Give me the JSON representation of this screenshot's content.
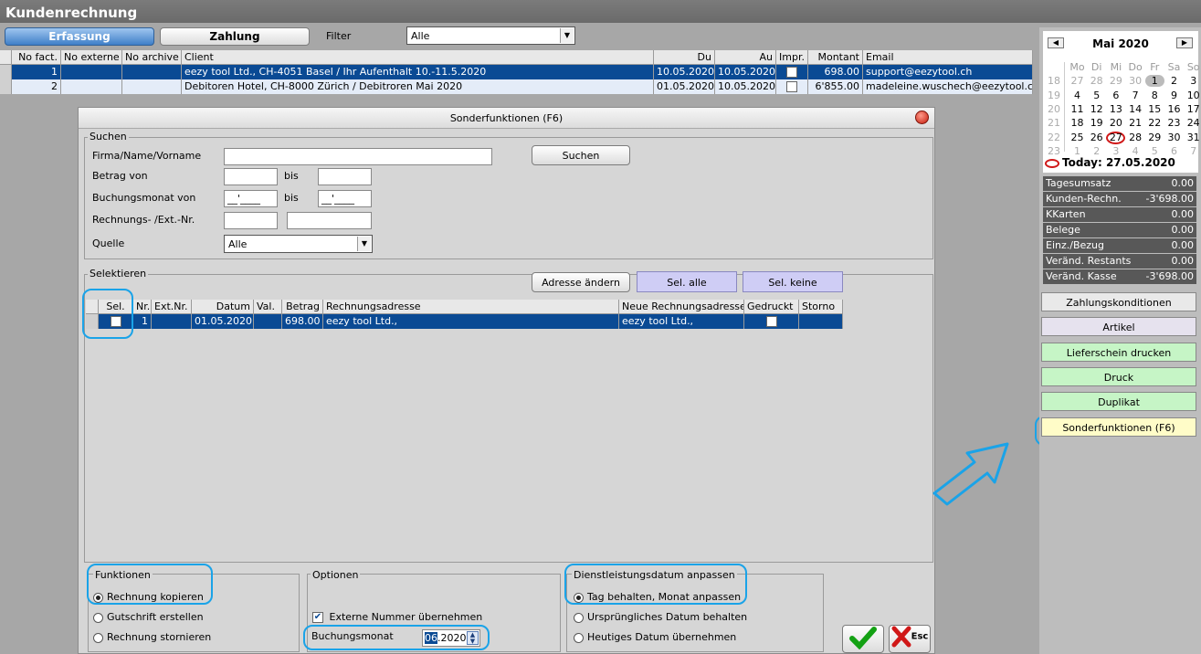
{
  "window": {
    "title": "Kundenrechnung"
  },
  "toolbar": {
    "tab_erfassung": "Erfassung",
    "tab_zahlung": "Zahlung",
    "filter_label": "Filter",
    "filter_value": "Alle"
  },
  "main_table": {
    "headers": [
      "No fact.",
      "No externe",
      "No archive",
      "Client",
      "Du",
      "Au",
      "Impr.",
      "Montant",
      "Email"
    ],
    "rows": [
      {
        "no": "1",
        "ext": "",
        "arch": "",
        "client": "eezy tool Ltd., CH-4051 Basel / Ihr Aufenthalt 10.-11.5.2020",
        "du": "10.05.2020",
        "au": "10.05.2020",
        "montant": "698.00",
        "email": "support@eezytool.ch"
      },
      {
        "no": "2",
        "ext": "",
        "arch": "",
        "client": "Debitoren Hotel, CH-8000 Zürich / Debitroren Mai 2020",
        "du": "01.05.2020",
        "au": "10.05.2020",
        "montant": "6'855.00",
        "email": "madeleine.wuschech@eezytool.ch"
      }
    ]
  },
  "dialog": {
    "title": "Sonderfunktionen (F6)",
    "suchen": {
      "group": "Suchen",
      "firma_label": "Firma/Name/Vorname",
      "betrag_label": "Betrag von",
      "bis1": "bis",
      "buchungsmonat_label": "Buchungsmonat von",
      "buch_from": "__'____",
      "bis2": "bis",
      "buch_to": "__'____",
      "rechnung_label": "Rechnungs- /Ext.-Nr.",
      "quelle_label": "Quelle",
      "quelle_value": "Alle",
      "suchen_button": "Suchen"
    },
    "selektieren": {
      "group": "Selektieren",
      "adresse_button": "Adresse ändern",
      "sel_alle_button": "Sel. alle",
      "sel_keine_button": "Sel. keine",
      "headers": [
        "Sel.",
        "Nr.",
        "Ext.Nr.",
        "Datum",
        "Val.",
        "Betrag",
        "Rechnungsadresse",
        "Neue Rechnungsadresse",
        "Gedruckt",
        "Storno"
      ],
      "rows": [
        {
          "nr": "1",
          "ext": "",
          "datum": "01.05.2020",
          "val": "",
          "betrag": "698.00",
          "adresse": "eezy tool Ltd.,",
          "neue": "eezy tool Ltd.,"
        }
      ]
    },
    "funktionen": {
      "group": "Funktionen",
      "opt1": "Rechnung kopieren",
      "opt2": "Gutschrift erstellen",
      "opt3": "Rechnung stornieren"
    },
    "optionen": {
      "group": "Optionen",
      "externe": "Externe Nummer übernehmen",
      "buchungsmonat_label": "Buchungsmonat",
      "buchungsmonat_value_sel": "06",
      "buchungsmonat_value_rest": ".2020"
    },
    "dienst": {
      "group": "Dienstleistungsdatum anpassen",
      "opt1": "Tag behalten, Monat anpassen",
      "opt2": "Ursprüngliches Datum behalten",
      "opt3": "Heutiges Datum übernehmen"
    },
    "esc_label": "Esc"
  },
  "calendar": {
    "month": "Mai 2020",
    "weekdays": [
      "Mo",
      "Di",
      "Mi",
      "Do",
      "Fr",
      "Sa",
      "So"
    ],
    "weeks": [
      {
        "wk": "18",
        "days": [
          "27",
          "28",
          "29",
          "30",
          "1",
          "2",
          "3"
        ]
      },
      {
        "wk": "19",
        "days": [
          "4",
          "5",
          "6",
          "7",
          "8",
          "9",
          "10"
        ]
      },
      {
        "wk": "20",
        "days": [
          "11",
          "12",
          "13",
          "14",
          "15",
          "16",
          "17"
        ]
      },
      {
        "wk": "21",
        "days": [
          "18",
          "19",
          "20",
          "21",
          "22",
          "23",
          "24"
        ]
      },
      {
        "wk": "22",
        "days": [
          "25",
          "26",
          "27",
          "28",
          "29",
          "30",
          "31"
        ]
      },
      {
        "wk": "23",
        "days": [
          "1",
          "2",
          "3",
          "4",
          "5",
          "6",
          "7"
        ]
      }
    ],
    "today": "Today: 27.05.2020"
  },
  "stats": [
    {
      "label": "Tagesumsatz",
      "value": "0.00"
    },
    {
      "label": "Kunden-Rechn.",
      "value": "-3'698.00"
    },
    {
      "label": "KKarten",
      "value": "0.00"
    },
    {
      "label": "Belege",
      "value": "0.00"
    },
    {
      "label": "Einz./Bezug",
      "value": "0.00"
    },
    {
      "label": "Veränd. Restants",
      "value": "0.00"
    },
    {
      "label": "Veränd. Kasse",
      "value": "-3'698.00"
    }
  ],
  "side_buttons": [
    "Zahlungskonditionen",
    "Artikel",
    "Lieferschein drucken",
    "Druck",
    "Duplikat",
    "Sonderfunktionen (F6)"
  ],
  "colors": {
    "selection": "#0a4a94",
    "highlight": "#1aa3e8",
    "green_btn": "#c6f5c6",
    "purple_btn": "#cfcdf5",
    "yellow_btn": "#fffcc8"
  }
}
